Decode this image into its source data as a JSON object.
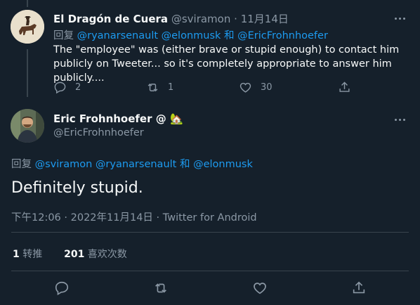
{
  "reply_tweet": {
    "author_name": "El Dragón de Cuera",
    "author_handle": "@sviramon",
    "date": "11月14日",
    "replying_prefix": "回复",
    "replying_to": [
      "@ryanarsenault",
      "@elonmusk",
      "@EricFrohnhoefer"
    ],
    "replying_joiner": "和",
    "text": "The \"employee\" was (either brave or stupid enough) to contact him publicly on Tweeter... so it's completely appropriate to answer him publicly....",
    "reply_count": "2",
    "retweet_count": "1",
    "like_count": "30"
  },
  "main_tweet": {
    "author_name": "Eric Frohnhoefer @",
    "author_emoji": "🏡",
    "author_handle": "@EricFrohnhoefer",
    "replying_prefix": "回复",
    "replying_to": [
      "@sviramon",
      "@ryanarsenault",
      "@elonmusk"
    ],
    "replying_joiner": "和",
    "text": "Definitely stupid.",
    "time": "下午12:06",
    "date": "2022年11月14日",
    "source": "Twitter for Android",
    "separator": "·",
    "retweets_count": "1",
    "retweets_label": "转推",
    "likes_count": "201",
    "likes_label": "喜欢次数"
  },
  "icons": [
    "more-icon",
    "reply-icon",
    "retweet-icon",
    "like-icon",
    "share-icon"
  ],
  "colors": {
    "background": "#15202b",
    "link": "#1d9bf0",
    "muted": "#8b98a5",
    "text": "#f7f9f9",
    "border": "#38444d"
  }
}
